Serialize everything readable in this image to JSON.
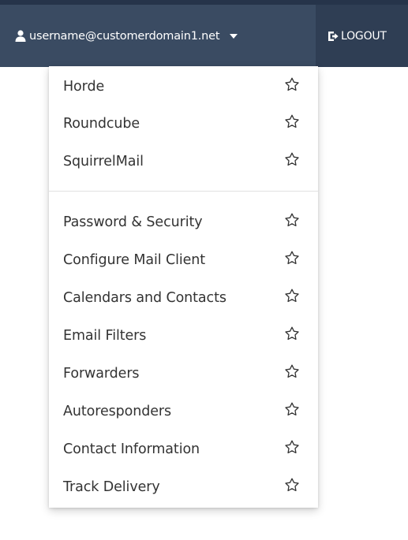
{
  "header": {
    "username": "username@customerdomain1.net",
    "logout_label": "LOGOUT",
    "user_icon": "user-icon",
    "caret_icon": "caret-down-icon",
    "logout_icon": "logout-icon",
    "colors": {
      "bar": "#2f3e54",
      "user_menu_bg": "#3a4b62",
      "text": "#ffffff"
    }
  },
  "menu": {
    "webmail": [
      {
        "label": "Horde",
        "icon": "star-icon"
      },
      {
        "label": "Roundcube",
        "icon": "star-icon"
      },
      {
        "label": "SquirrelMail",
        "icon": "star-icon"
      }
    ],
    "settings": [
      {
        "label": "Password & Security",
        "icon": "star-icon"
      },
      {
        "label": "Configure Mail Client",
        "icon": "star-icon"
      },
      {
        "label": "Calendars and Contacts",
        "icon": "star-icon"
      },
      {
        "label": "Email Filters",
        "icon": "star-icon"
      },
      {
        "label": "Forwarders",
        "icon": "star-icon"
      },
      {
        "label": "Autoresponders",
        "icon": "star-icon"
      },
      {
        "label": "Contact Information",
        "icon": "star-icon"
      },
      {
        "label": "Track Delivery",
        "icon": "star-icon"
      }
    ]
  }
}
